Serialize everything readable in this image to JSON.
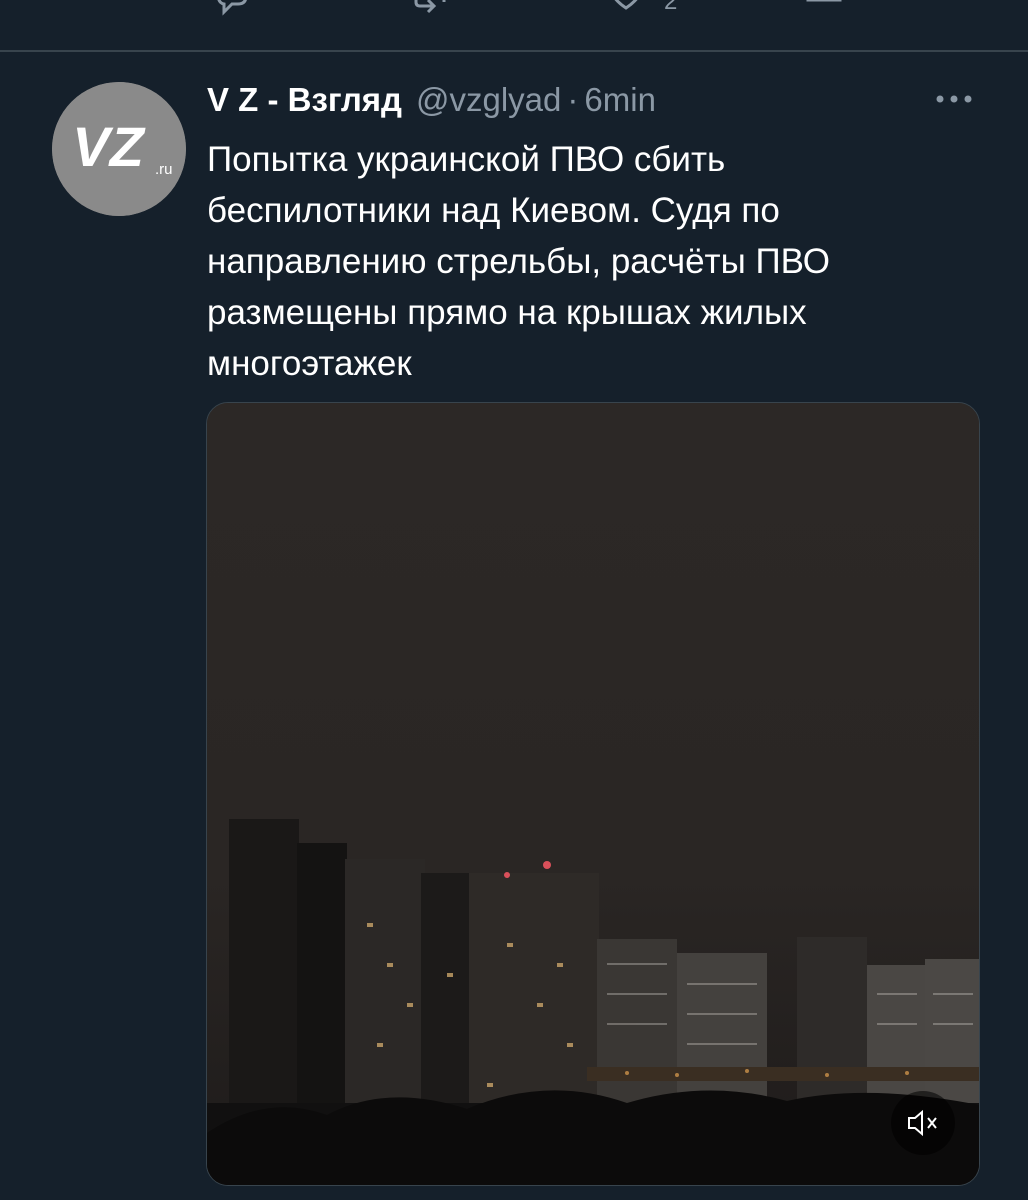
{
  "previous_tweet": {
    "like_count": "2"
  },
  "tweet": {
    "avatar_text": "VZ",
    "avatar_suffix": ".ru",
    "display_name": "V Z - Взгляд",
    "handle": "@vzglyad",
    "separator": "·",
    "timestamp": "6min",
    "text_lines": [
      "Попытка украинской ПВО сбить",
      "беспилотники над Киевом. Судя по",
      "направлению стрельбы, расчёты ПВО",
      "размещены прямо на крышах жилых",
      "многоэтажек"
    ],
    "media": {
      "type": "video",
      "mute_icon": "speaker-muted-icon"
    }
  },
  "icons": {
    "reply": "reply-icon",
    "retweet": "retweet-icon",
    "like": "like-icon",
    "share": "share-icon",
    "more": "more-icon"
  },
  "colors": {
    "background": "#15202b",
    "divider": "#38444d",
    "secondary_text": "#8b98a5",
    "primary_text": "#ffffff"
  }
}
